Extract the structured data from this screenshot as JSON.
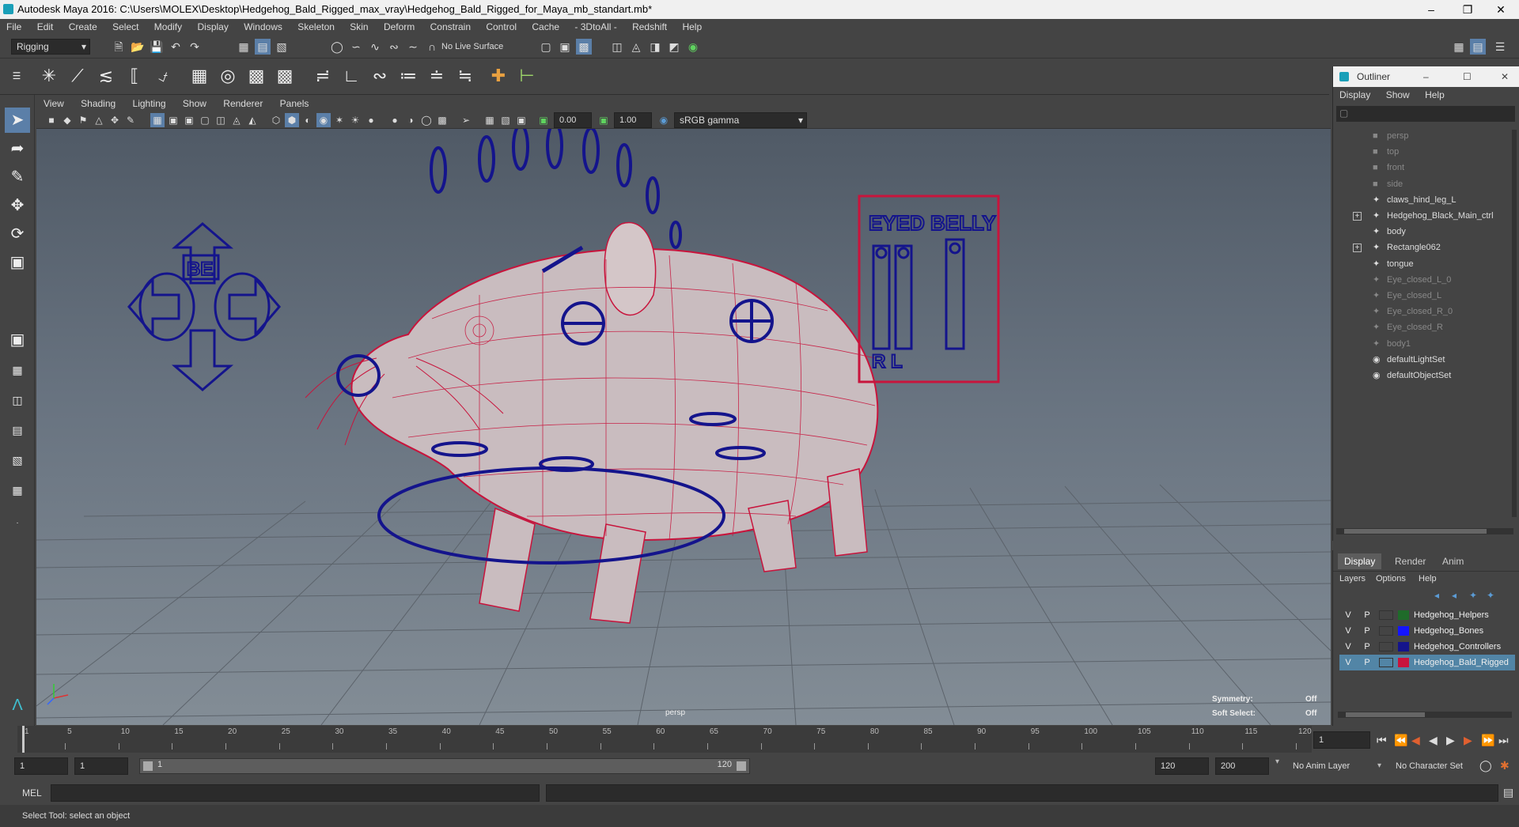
{
  "window": {
    "title": "Autodesk Maya 2016: C:\\Users\\MOLEX\\Desktop\\Hedgehog_Bald_Rigged_max_vray\\Hedgehog_Bald_Rigged_for_Maya_mb_standart.mb*"
  },
  "menus": [
    "File",
    "Edit",
    "Create",
    "Select",
    "Modify",
    "Display",
    "Windows",
    "Skeleton",
    "Skin",
    "Deform",
    "Constrain",
    "Control",
    "Cache",
    "- 3DtoAll -",
    "Redshift",
    "Help"
  ],
  "statusline": {
    "mode": "Rigging",
    "live_surface": "No Live Surface"
  },
  "panel": {
    "menus": [
      "View",
      "Shading",
      "Lighting",
      "Show",
      "Renderer",
      "Panels"
    ],
    "exposure": "0.00",
    "gamma": "1.00",
    "color_space": "sRGB gamma",
    "camera_label": "persp",
    "hud": {
      "symmetry_label": "Symmetry:",
      "symmetry_value": "Off",
      "soft_select_label": "Soft Select:",
      "soft_select_value": "Off"
    },
    "control_text_left": "BE",
    "control_text_right": "EYED BELLY",
    "control_text_rl": "R L"
  },
  "outliner": {
    "title": "Outliner",
    "menus": [
      "Display",
      "Show",
      "Help"
    ],
    "items": [
      {
        "label": "persp",
        "dim": true,
        "expand": false,
        "icon": "camera-icon"
      },
      {
        "label": "top",
        "dim": true,
        "expand": false,
        "icon": "camera-icon"
      },
      {
        "label": "front",
        "dim": true,
        "expand": false,
        "icon": "camera-icon"
      },
      {
        "label": "side",
        "dim": true,
        "expand": false,
        "icon": "camera-icon"
      },
      {
        "label": "claws_hind_leg_L",
        "dim": false,
        "expand": false,
        "icon": "transform-icon"
      },
      {
        "label": "Hedgehog_Black_Main_ctrl",
        "dim": false,
        "expand": true,
        "icon": "transform-icon"
      },
      {
        "label": "body",
        "dim": false,
        "expand": false,
        "icon": "transform-icon"
      },
      {
        "label": "Rectangle062",
        "dim": false,
        "expand": true,
        "icon": "transform-icon"
      },
      {
        "label": "tongue",
        "dim": false,
        "expand": false,
        "icon": "transform-icon"
      },
      {
        "label": "Eye_closed_L_0",
        "dim": true,
        "expand": false,
        "icon": "transform-icon"
      },
      {
        "label": "Eye_closed_L",
        "dim": true,
        "expand": false,
        "icon": "transform-icon"
      },
      {
        "label": "Eye_closed_R_0",
        "dim": true,
        "expand": false,
        "icon": "transform-icon"
      },
      {
        "label": "Eye_closed_R",
        "dim": true,
        "expand": false,
        "icon": "transform-icon"
      },
      {
        "label": "body1",
        "dim": true,
        "expand": false,
        "icon": "transform-icon"
      },
      {
        "label": "defaultLightSet",
        "dim": false,
        "expand": false,
        "icon": "set-icon"
      },
      {
        "label": "defaultObjectSet",
        "dim": false,
        "expand": false,
        "icon": "set-icon"
      }
    ]
  },
  "layer_editor": {
    "tabs": [
      "Display",
      "Render",
      "Anim"
    ],
    "menus": [
      "Layers",
      "Options",
      "Help"
    ],
    "layers": [
      {
        "v": "V",
        "p": "P",
        "color": "#1f6b2a",
        "name": "Hedgehog_Helpers",
        "selected": false
      },
      {
        "v": "V",
        "p": "P",
        "color": "#1414ff",
        "name": "Hedgehog_Bones",
        "selected": false
      },
      {
        "v": "V",
        "p": "P",
        "color": "#14148c",
        "name": "Hedgehog_Controllers",
        "selected": false
      },
      {
        "v": "V",
        "p": "P",
        "color": "#c8143c",
        "name": "Hedgehog_Bald_Rigged",
        "selected": true
      }
    ]
  },
  "timeline": {
    "ticks": [
      "1",
      "5",
      "10",
      "15",
      "20",
      "25",
      "30",
      "35",
      "40",
      "45",
      "50",
      "55",
      "60",
      "65",
      "70",
      "75",
      "80",
      "85",
      "90",
      "95",
      "100",
      "105",
      "110",
      "115",
      "120"
    ],
    "current_frame": "1"
  },
  "range": {
    "start": "1",
    "playback_start": "1",
    "slider_start": "1",
    "slider_end": "120",
    "playback_end": "120",
    "end": "200",
    "anim_layer": "No Anim Layer",
    "character_set": "No Character Set"
  },
  "cmdline": {
    "lang": "MEL"
  },
  "helpline": {
    "text": "Select Tool: select an object"
  },
  "colors": {
    "wire": "#c8143c",
    "controls": "#14148c",
    "accent": "#5b9bd5"
  }
}
